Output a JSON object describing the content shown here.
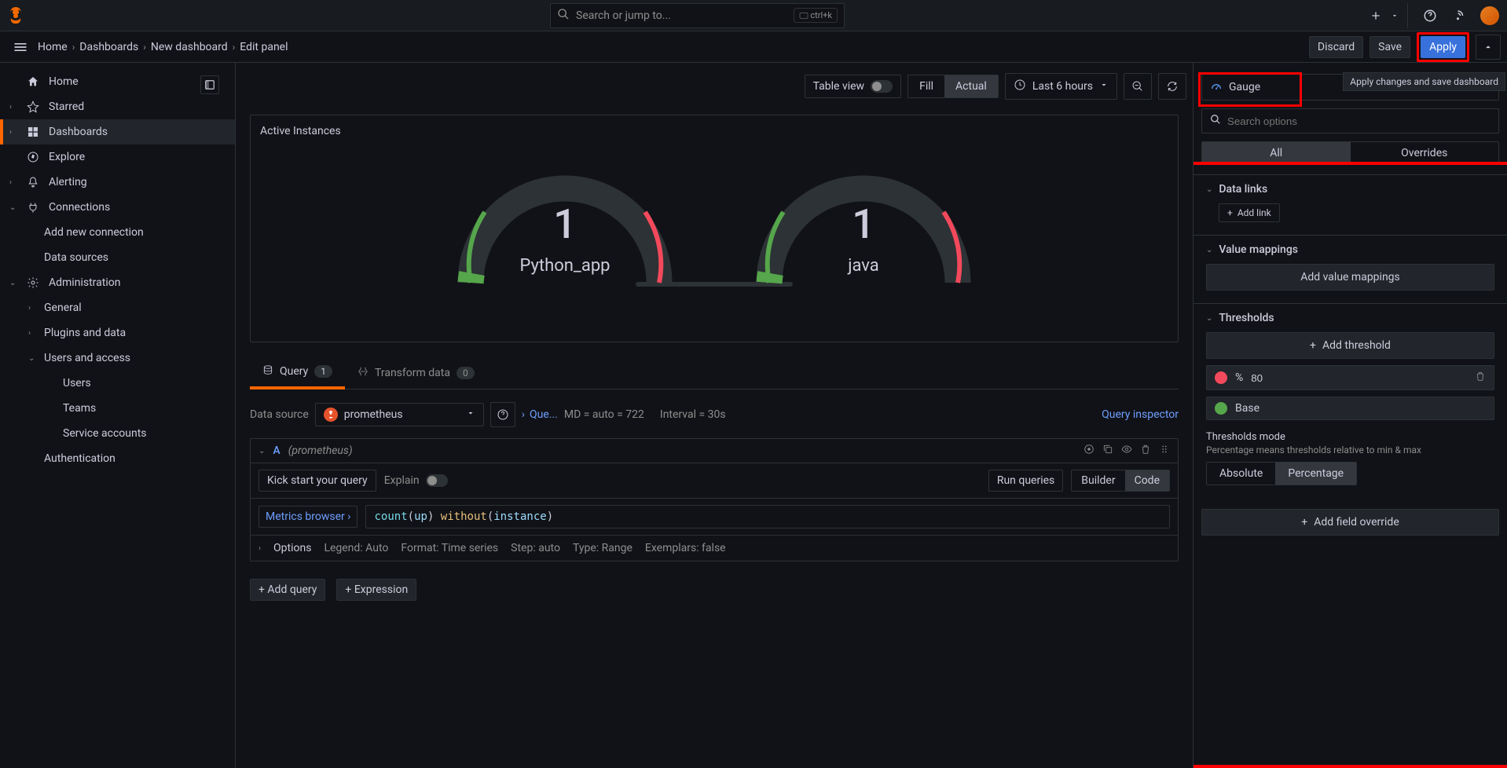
{
  "top": {
    "search_placeholder": "Search or jump to...",
    "kbd": "ctrl+k"
  },
  "breadcrumbs": {
    "home": "Home",
    "dashboards": "Dashboards",
    "new_dashboard": "New dashboard",
    "edit_panel": "Edit panel"
  },
  "actions": {
    "discard": "Discard",
    "save": "Save",
    "apply": "Apply",
    "tooltip": "Apply changes and save dashboard"
  },
  "sidebar": {
    "items": [
      {
        "label": "Home"
      },
      {
        "label": "Starred"
      },
      {
        "label": "Dashboards"
      },
      {
        "label": "Explore"
      },
      {
        "label": "Alerting"
      },
      {
        "label": "Connections"
      },
      {
        "label": "Add new connection"
      },
      {
        "label": "Data sources"
      },
      {
        "label": "Administration"
      },
      {
        "label": "General"
      },
      {
        "label": "Plugins and data"
      },
      {
        "label": "Users and access"
      },
      {
        "label": "Users"
      },
      {
        "label": "Teams"
      },
      {
        "label": "Service accounts"
      },
      {
        "label": "Authentication"
      }
    ]
  },
  "toolbar": {
    "table_view": "Table view",
    "fill": "Fill",
    "actual": "Actual",
    "time_range": "Last 6 hours"
  },
  "panel": {
    "title": "Active Instances",
    "gauges": [
      {
        "value": "1",
        "label": "Python_app"
      },
      {
        "value": "1",
        "label": "java"
      }
    ]
  },
  "tabs": {
    "query": "Query",
    "query_count": "1",
    "transform": "Transform data",
    "transform_count": "0"
  },
  "ds": {
    "label": "Data source",
    "name": "prometheus",
    "path": "Que...",
    "md": "MD = auto = 722",
    "interval": "Interval = 30s",
    "inspector": "Query inspector"
  },
  "query": {
    "letter": "A",
    "name": "(prometheus)",
    "kick_start": "Kick start your query",
    "explain": "Explain",
    "run": "Run queries",
    "builder": "Builder",
    "code": "Code",
    "metrics_browser": "Metrics browser",
    "expr_fn": "count",
    "expr_arg": "up",
    "expr_kw": "without",
    "expr_inst": "instance"
  },
  "options": {
    "label": "Options",
    "legend": "Legend: Auto",
    "format": "Format: Time series",
    "step": "Step: auto",
    "type": "Type: Range",
    "exemplars": "Exemplars: false"
  },
  "add": {
    "query": "Add query",
    "expression": "Expression"
  },
  "right": {
    "viz_type": "Gauge",
    "search_placeholder": "Search options",
    "all": "All",
    "overrides": "Overrides",
    "data_links": "Data links",
    "add_link": "Add link",
    "value_mappings": "Value mappings",
    "add_value_mappings": "Add value mappings",
    "thresholds": "Thresholds",
    "add_threshold": "Add threshold",
    "threshold_pct": "%",
    "threshold_value": "80",
    "threshold_base": "Base",
    "thresholds_mode": "Thresholds mode",
    "thresholds_mode_desc": "Percentage means thresholds relative to min & max",
    "absolute": "Absolute",
    "percentage": "Percentage",
    "add_field_override": "Add field override",
    "threshold_color_80": "#f2495c",
    "threshold_color_base": "#56a64b"
  }
}
